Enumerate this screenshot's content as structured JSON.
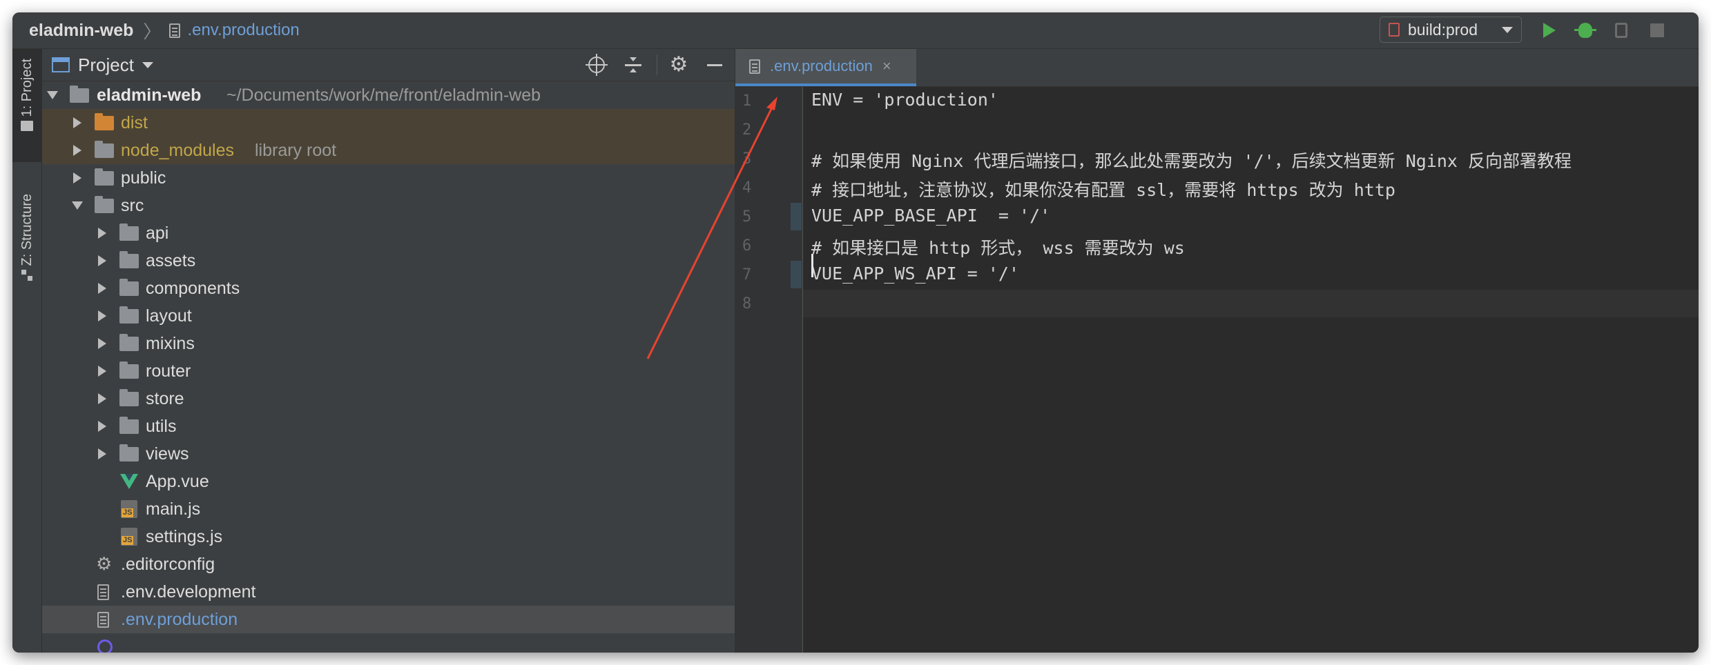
{
  "titlebar": {
    "project_name": "eladmin-web",
    "separator": "〉",
    "file_name": ".env.production",
    "run_config": "build:prod"
  },
  "toolstrip": {
    "project_tab": "1: Project",
    "structure_tab": "Z: Structure"
  },
  "project_panel": {
    "title": "Project",
    "root_name": "eladmin-web",
    "root_path": "~/Documents/work/me/front/eladmin-web",
    "items": [
      {
        "label": "dist",
        "hint": ""
      },
      {
        "label": "node_modules",
        "hint": "library root"
      },
      {
        "label": "public",
        "hint": ""
      },
      {
        "label": "src",
        "hint": ""
      },
      {
        "label": "api"
      },
      {
        "label": "assets"
      },
      {
        "label": "components"
      },
      {
        "label": "layout"
      },
      {
        "label": "mixins"
      },
      {
        "label": "router"
      },
      {
        "label": "store"
      },
      {
        "label": "utils"
      },
      {
        "label": "views"
      },
      {
        "label": "App.vue"
      },
      {
        "label": "main.js"
      },
      {
        "label": "settings.js"
      },
      {
        "label": ".editorconfig"
      },
      {
        "label": ".env.development"
      },
      {
        "label": ".env.production"
      }
    ]
  },
  "editor": {
    "tab_label": ".env.production",
    "tab_close": "×",
    "line_numbers": [
      "1",
      "2",
      "3",
      "4",
      "5",
      "6",
      "7",
      "8"
    ],
    "lines": [
      "ENV = 'production'",
      "",
      "# 如果使用 Nginx 代理后端接口，那么此处需要改为 '/'，后续文档更新 Nginx 反向部署教程",
      "# 接口地址，注意协议，如果你没有配置 ssl，需要将 https 改为 http",
      "VUE_APP_BASE_API  = '/'",
      "# 如果接口是 http 形式， wss 需要改为 ws",
      "VUE_APP_WS_API = '/'",
      ""
    ]
  },
  "colors": {
    "accent": "#4a88c7",
    "file_link": "#6e9fd8",
    "excluded_text": "#c2a64a",
    "run_green": "#4cae4f",
    "annotation_red": "#e8432f"
  }
}
